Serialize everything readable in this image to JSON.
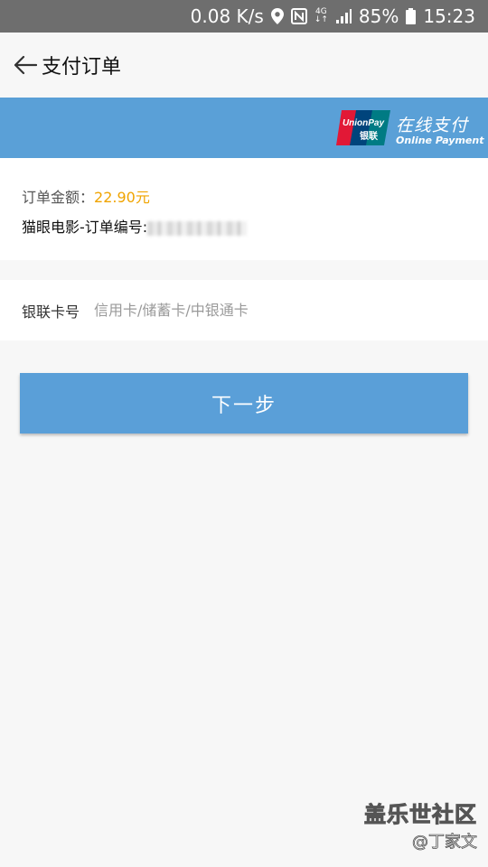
{
  "status_bar": {
    "speed": "0.08 K/s",
    "network_type": "4G",
    "battery": "85%",
    "time": "15:23",
    "icons": [
      "location-icon",
      "nfc-icon",
      "data-arrows-icon",
      "signal-icon",
      "battery-icon"
    ]
  },
  "app_bar": {
    "title": "支付订单",
    "back_icon": "arrow-left-icon"
  },
  "banner": {
    "logo_text_top": "UnionPay",
    "logo_text_bottom": "银联",
    "title": "在线支付",
    "subtitle": "Online Payment",
    "color": "#5aa0d7"
  },
  "order": {
    "amount_label": "订单金额：",
    "amount_value": "22.90元",
    "amount_color": "#f0a400",
    "number_label": "猫眼电影-订单编号:"
  },
  "card_input": {
    "label": "银联卡号",
    "placeholder": "信用卡/储蓄卡/中银通卡",
    "value": ""
  },
  "next_button": {
    "label": "下一步",
    "color": "#5a9fd8"
  },
  "watermark": {
    "line1": "盖乐世社区",
    "line2": "@丁家文"
  }
}
